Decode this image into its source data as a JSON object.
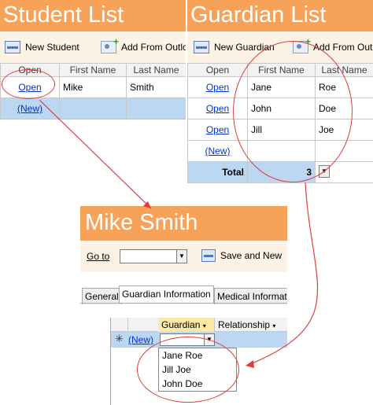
{
  "student_list": {
    "title": "Student List",
    "toolbar": {
      "new_label": "New Student",
      "add_label": "Add From Outlook"
    },
    "columns": [
      "Open",
      "First Name",
      "Last Name"
    ],
    "rows": [
      {
        "open": "Open",
        "first": "Mike",
        "last": "Smith"
      }
    ],
    "new_label": "(New)"
  },
  "guardian_list": {
    "title": "Guardian List",
    "toolbar": {
      "new_label": "New Guardian",
      "add_label": "Add From Outlook"
    },
    "columns": [
      "Open",
      "First Name",
      "Last Name"
    ],
    "rows": [
      {
        "open": "Open",
        "first": "Jane",
        "last": "Roe"
      },
      {
        "open": "Open",
        "first": "John",
        "last": "Doe"
      },
      {
        "open": "Open",
        "first": "Jill",
        "last": "Joe"
      }
    ],
    "new_label": "(New)",
    "total_label": "Total",
    "total_value": "3"
  },
  "student_form": {
    "title": "Mike Smith",
    "goto_label": "Go to",
    "goto_value": "",
    "save_new_label": "Save and New",
    "tabs": [
      "General",
      "Guardian Information",
      "Medical Information"
    ],
    "subgrid": {
      "columns": [
        "Guardian",
        "Relationship"
      ],
      "new_label": "(New)",
      "guardian_value": "",
      "options": [
        "Jane Roe",
        "Jill Joe",
        "John Doe"
      ]
    }
  },
  "colors": {
    "title_bar": "#f7a259",
    "highlight_row": "#bcd7f2",
    "annotation": "#e03c3c"
  }
}
